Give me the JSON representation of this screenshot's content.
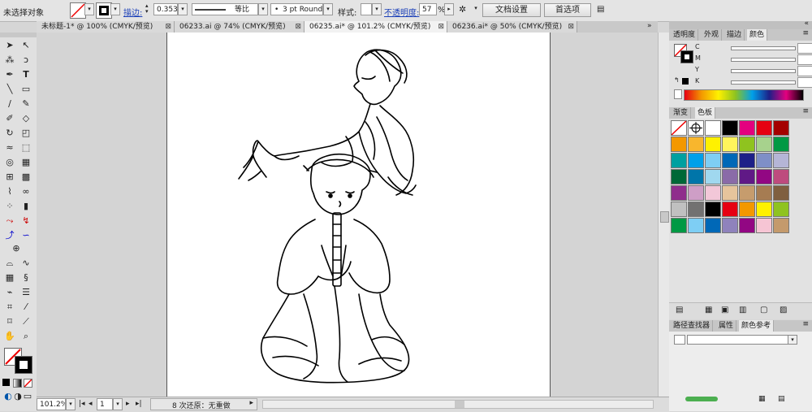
{
  "control_bar": {
    "selection_status": "未选择对象",
    "stroke_label": "描边:",
    "stroke_weight": "0.353",
    "stroke_profile": "等比",
    "brush": "3 pt Round",
    "style_label": "样式:",
    "opacity_label": "不透明度:",
    "opacity_value": "57",
    "opacity_unit": "%",
    "doc_setup_button": "文档设置",
    "preferences_button": "首选项"
  },
  "tabs": [
    {
      "label": "未标题-1* @ 100% (CMYK/预览)",
      "active": false
    },
    {
      "label": "06233.ai @ 74% (CMYK/预览)",
      "active": false
    },
    {
      "label": "06235.ai* @ 101.2% (CMYK/预览)",
      "active": true
    },
    {
      "label": "06236.ai* @ 50% (CMYK/预览)",
      "active": false
    }
  ],
  "tab_close": "⊠",
  "status_bar": {
    "zoom": "101.2%",
    "page": "1",
    "undo_status": "8 次还原：无重做"
  },
  "color_panel": {
    "tabs": [
      "透明度",
      "外观",
      "描边",
      "颜色"
    ],
    "channels": [
      {
        "name": "C",
        "unit": "%"
      },
      {
        "name": "M",
        "unit": "%"
      },
      {
        "name": "Y",
        "unit": "%"
      },
      {
        "name": "K",
        "unit": "%"
      }
    ]
  },
  "swatch_panel": {
    "tabs": [
      "渐变",
      "色板"
    ],
    "swatches": [
      "none",
      "#ffffff",
      "#ffffff",
      "#000000",
      "#e4007f",
      "#e60012",
      "#a40000",
      "#f39800",
      "#f8b62d",
      "#fff100",
      "#fff45c",
      "#8fc31f",
      "#a7d28d",
      "#009944",
      "#00a0a0",
      "#00a0e9",
      "#7ecef4",
      "#0068b7",
      "#1d2088",
      "#7f8fc7",
      "#b5b5d6",
      "#006837",
      "#0075a9",
      "#a0d8ef",
      "#8a6ba8",
      "#601986",
      "#920783",
      "#be4b7e",
      "#8f2e8c",
      "#ce9ec6",
      "#f2c7d8",
      "#e6c49c",
      "#c69c6d",
      "#a67c52",
      "#7f5f3f",
      "#c0c0c0",
      "#727171",
      "#000000",
      "#e60012",
      "#f39800",
      "#fff100",
      "#8fc31f",
      "#009944",
      "#7ecef4",
      "#0068b7",
      "#8f82bc",
      "#920783",
      "#f6c5d4",
      "#c49a6c"
    ]
  },
  "bottom_panel": {
    "tabs": [
      "路径查找器",
      "属性",
      "颜色参考"
    ]
  },
  "icons": {
    "tools": [
      "selection-icon",
      "direct-selection-icon",
      "magic-wand-icon",
      "lasso-icon",
      "pen-icon",
      "type-icon",
      "line-icon",
      "rectangle-icon",
      "paintbrush-icon",
      "pencil-icon",
      "blob-brush-icon",
      "eraser-icon",
      "rotate-icon",
      "scale-icon",
      "warp-icon",
      "free-transform-icon",
      "shape-builder-icon",
      "perspective-icon",
      "mesh-icon",
      "gradient-icon",
      "eyedropper-icon",
      "blend-icon",
      "symbol-sprayer-icon",
      "column-graph-icon",
      "artboard-icon",
      "slice-icon",
      "hand-icon",
      "zoom-icon"
    ]
  }
}
